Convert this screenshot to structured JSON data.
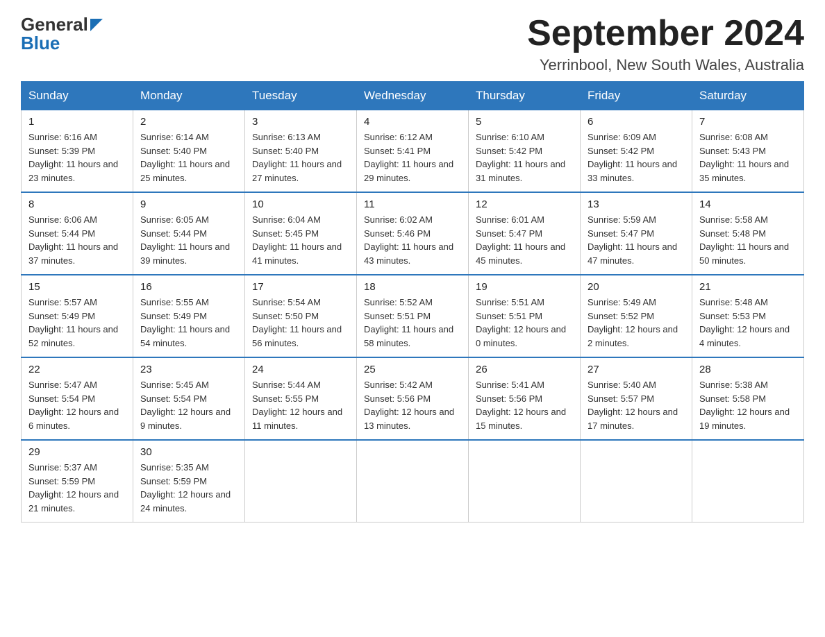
{
  "header": {
    "logo_general": "General",
    "logo_blue": "Blue",
    "month_title": "September 2024",
    "location": "Yerrinbool, New South Wales, Australia"
  },
  "days_of_week": [
    "Sunday",
    "Monday",
    "Tuesday",
    "Wednesday",
    "Thursday",
    "Friday",
    "Saturday"
  ],
  "weeks": [
    [
      {
        "day": "1",
        "sunrise": "6:16 AM",
        "sunset": "5:39 PM",
        "daylight": "11 hours and 23 minutes."
      },
      {
        "day": "2",
        "sunrise": "6:14 AM",
        "sunset": "5:40 PM",
        "daylight": "11 hours and 25 minutes."
      },
      {
        "day": "3",
        "sunrise": "6:13 AM",
        "sunset": "5:40 PM",
        "daylight": "11 hours and 27 minutes."
      },
      {
        "day": "4",
        "sunrise": "6:12 AM",
        "sunset": "5:41 PM",
        "daylight": "11 hours and 29 minutes."
      },
      {
        "day": "5",
        "sunrise": "6:10 AM",
        "sunset": "5:42 PM",
        "daylight": "11 hours and 31 minutes."
      },
      {
        "day": "6",
        "sunrise": "6:09 AM",
        "sunset": "5:42 PM",
        "daylight": "11 hours and 33 minutes."
      },
      {
        "day": "7",
        "sunrise": "6:08 AM",
        "sunset": "5:43 PM",
        "daylight": "11 hours and 35 minutes."
      }
    ],
    [
      {
        "day": "8",
        "sunrise": "6:06 AM",
        "sunset": "5:44 PM",
        "daylight": "11 hours and 37 minutes."
      },
      {
        "day": "9",
        "sunrise": "6:05 AM",
        "sunset": "5:44 PM",
        "daylight": "11 hours and 39 minutes."
      },
      {
        "day": "10",
        "sunrise": "6:04 AM",
        "sunset": "5:45 PM",
        "daylight": "11 hours and 41 minutes."
      },
      {
        "day": "11",
        "sunrise": "6:02 AM",
        "sunset": "5:46 PM",
        "daylight": "11 hours and 43 minutes."
      },
      {
        "day": "12",
        "sunrise": "6:01 AM",
        "sunset": "5:47 PM",
        "daylight": "11 hours and 45 minutes."
      },
      {
        "day": "13",
        "sunrise": "5:59 AM",
        "sunset": "5:47 PM",
        "daylight": "11 hours and 47 minutes."
      },
      {
        "day": "14",
        "sunrise": "5:58 AM",
        "sunset": "5:48 PM",
        "daylight": "11 hours and 50 minutes."
      }
    ],
    [
      {
        "day": "15",
        "sunrise": "5:57 AM",
        "sunset": "5:49 PM",
        "daylight": "11 hours and 52 minutes."
      },
      {
        "day": "16",
        "sunrise": "5:55 AM",
        "sunset": "5:49 PM",
        "daylight": "11 hours and 54 minutes."
      },
      {
        "day": "17",
        "sunrise": "5:54 AM",
        "sunset": "5:50 PM",
        "daylight": "11 hours and 56 minutes."
      },
      {
        "day": "18",
        "sunrise": "5:52 AM",
        "sunset": "5:51 PM",
        "daylight": "11 hours and 58 minutes."
      },
      {
        "day": "19",
        "sunrise": "5:51 AM",
        "sunset": "5:51 PM",
        "daylight": "12 hours and 0 minutes."
      },
      {
        "day": "20",
        "sunrise": "5:49 AM",
        "sunset": "5:52 PM",
        "daylight": "12 hours and 2 minutes."
      },
      {
        "day": "21",
        "sunrise": "5:48 AM",
        "sunset": "5:53 PM",
        "daylight": "12 hours and 4 minutes."
      }
    ],
    [
      {
        "day": "22",
        "sunrise": "5:47 AM",
        "sunset": "5:54 PM",
        "daylight": "12 hours and 6 minutes."
      },
      {
        "day": "23",
        "sunrise": "5:45 AM",
        "sunset": "5:54 PM",
        "daylight": "12 hours and 9 minutes."
      },
      {
        "day": "24",
        "sunrise": "5:44 AM",
        "sunset": "5:55 PM",
        "daylight": "12 hours and 11 minutes."
      },
      {
        "day": "25",
        "sunrise": "5:42 AM",
        "sunset": "5:56 PM",
        "daylight": "12 hours and 13 minutes."
      },
      {
        "day": "26",
        "sunrise": "5:41 AM",
        "sunset": "5:56 PM",
        "daylight": "12 hours and 15 minutes."
      },
      {
        "day": "27",
        "sunrise": "5:40 AM",
        "sunset": "5:57 PM",
        "daylight": "12 hours and 17 minutes."
      },
      {
        "day": "28",
        "sunrise": "5:38 AM",
        "sunset": "5:58 PM",
        "daylight": "12 hours and 19 minutes."
      }
    ],
    [
      {
        "day": "29",
        "sunrise": "5:37 AM",
        "sunset": "5:59 PM",
        "daylight": "12 hours and 21 minutes."
      },
      {
        "day": "30",
        "sunrise": "5:35 AM",
        "sunset": "5:59 PM",
        "daylight": "12 hours and 24 minutes."
      },
      null,
      null,
      null,
      null,
      null
    ]
  ],
  "labels": {
    "sunrise": "Sunrise:",
    "sunset": "Sunset:",
    "daylight": "Daylight:"
  }
}
